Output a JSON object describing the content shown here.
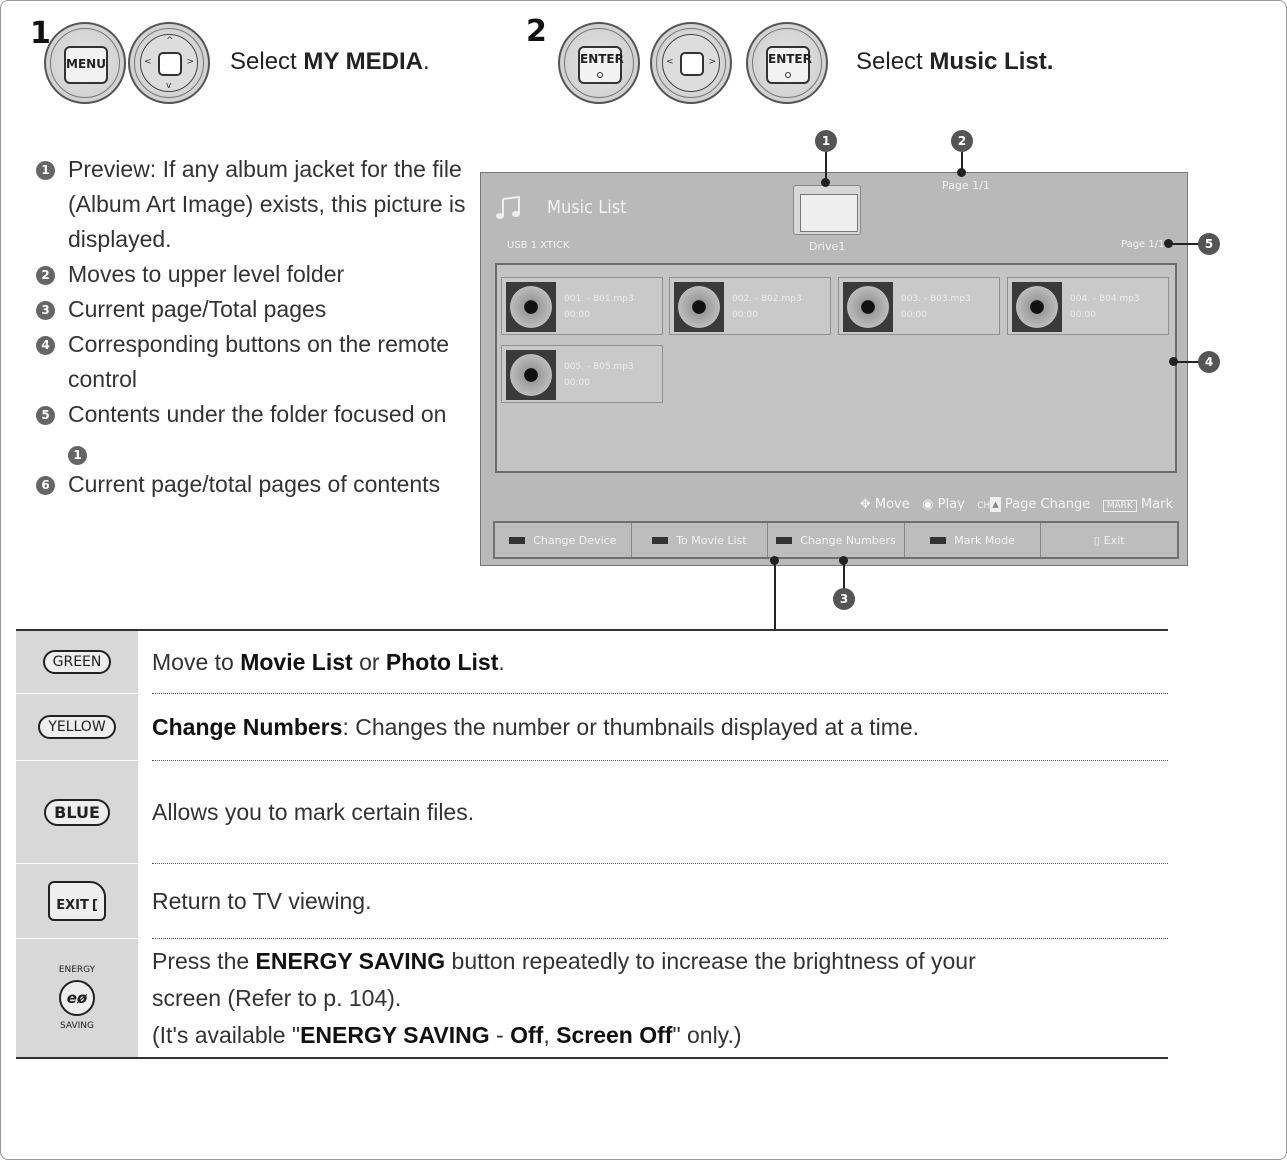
{
  "steps": [
    {
      "number": "1",
      "buttons": [
        "MENU",
        "navigation"
      ],
      "text_prefix": "Select ",
      "text_bold": "MY MEDIA",
      "text_suffix": "."
    },
    {
      "number": "2",
      "buttons": [
        "ENTER",
        "navigation",
        "ENTER"
      ],
      "text_prefix": "Select ",
      "text_bold": "Music List.",
      "text_suffix": ""
    }
  ],
  "legend": [
    {
      "num": "1",
      "text": "Preview: If any album jacket for the file (Album Art Image) exists, this picture is displayed."
    },
    {
      "num": "2",
      "text": "Moves to upper level folder"
    },
    {
      "num": "3",
      "text": "Current page/Total pages"
    },
    {
      "num": "4",
      "text": "Corresponding buttons on the remote control"
    },
    {
      "num": "5",
      "text_before": "Contents under the folder focused on ",
      "ref": "1"
    },
    {
      "num": "6",
      "text": "Current page/total pages of contents"
    }
  ],
  "screen": {
    "title": "Music List",
    "device": "USB 1 XTICK",
    "folder_label": "Drive1",
    "page_top": "Page 1/1",
    "page_right": "Page 1/1",
    "files": [
      {
        "name": "001. - B01.mp3",
        "time": "00:00"
      },
      {
        "name": "002. - B02.mp3",
        "time": "00:00"
      },
      {
        "name": "003. - B03.mp3",
        "time": "00:00"
      },
      {
        "name": "004. - B04.mp3",
        "time": "00:00"
      },
      {
        "name": "005. - B05.mp3",
        "time": "00:00"
      }
    ],
    "hints": {
      "move": "Move",
      "play": "Play",
      "ch": "CH",
      "page_change": "Page Change",
      "mark_key": "MARK",
      "mark": "Mark"
    },
    "bottom_buttons": [
      "Change Device",
      "To Movie List",
      "Change Numbers",
      "Mark Mode",
      "Exit"
    ],
    "callouts": [
      "1",
      "2",
      "3",
      "4",
      "5"
    ]
  },
  "table": [
    {
      "key": "GREEN",
      "desc_parts": [
        "Move to ",
        "Movie List",
        " or ",
        "Photo List",
        "."
      ]
    },
    {
      "key": "YELLOW",
      "desc_parts": [
        "Change Numbers",
        ": Changes the number or thumbnails displayed at a time."
      ]
    },
    {
      "key": "BLUE",
      "desc": "Allows you to mark certain files."
    },
    {
      "key": "EXIT",
      "desc": "Return to TV viewing."
    },
    {
      "key_top": "ENERGY",
      "key_bottom": "SAVING",
      "key_symbol": "eø",
      "line1_parts": [
        "Press the ",
        "ENERGY SAVING",
        " button repeatedly to increase the brightness of your"
      ],
      "line2": "screen (Refer to p. 104).",
      "line3_parts": [
        "(It's available \"",
        "ENERGY SAVING",
        " - ",
        "Off",
        ", ",
        "Screen Off",
        "\" only.)"
      ]
    }
  ]
}
